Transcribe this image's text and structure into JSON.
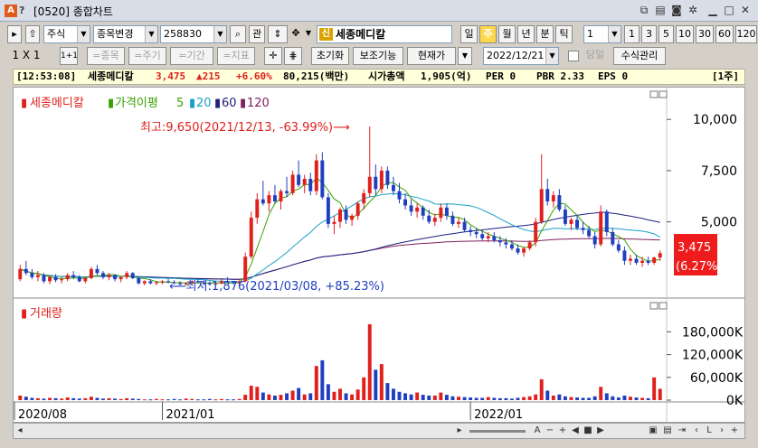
{
  "window": {
    "title": "[0520] 종합차트",
    "icons": [
      "app-icon",
      "help-icon",
      "new-window-icon",
      "copy-icon",
      "screenshot-icon",
      "settings-icon",
      "minimize-icon",
      "maximize-icon",
      "close-icon"
    ]
  },
  "toolbar1": {
    "market": "주식",
    "stock_change": "종목변경",
    "code": "258830",
    "search_icon": "search-icon",
    "relation_btn": "관",
    "stock_name": "세종메디칼",
    "stock_badge": "신",
    "period_buttons": [
      "일",
      "주",
      "월",
      "년",
      "분",
      "틱"
    ],
    "selected_period": "주",
    "unit_value": "1",
    "unit_buttons": [
      "1",
      "3",
      "5",
      "10",
      "30",
      "60",
      "120"
    ]
  },
  "toolbar2": {
    "layout": "1 X 1",
    "layout_btn": "1+1",
    "tools": [
      "=종목",
      "=주기",
      "=기간",
      "=지표"
    ],
    "reset_btn": "초기화",
    "aux_btn": "보조기능",
    "price_mode": "현재가",
    "date": "2022/12/21",
    "today_label": "당일",
    "formula_btn": "수식관리"
  },
  "infobar": {
    "time": "[12:53:08]",
    "name": "세종메디칼",
    "price": "3,475",
    "change": "▲215",
    "change_pct": "+6.60%",
    "volume": "80,215(백만)",
    "mcap_label": "시가총액",
    "mcap": "1,905(억)",
    "per": "PER 0",
    "pbr": "PBR 2.33",
    "eps": "EPS 0",
    "period_tag": "[1주]"
  },
  "chart": {
    "legend": {
      "stock": "세종메디칼",
      "ma_label": "가격이평",
      "ma": [
        "5",
        "20",
        "60",
        "120"
      ]
    },
    "high_note": "최고:9,650(2021/12/13, -63.99%)⟶",
    "low_note": "⟵최저:1,876(2021/03/08, +85.23%)",
    "price_ticks": [
      "10,000",
      "7,500",
      "5,000"
    ],
    "current_price": "3,475",
    "current_pct": "(6.27%)",
    "volume_label": "거래량",
    "volume_ticks": [
      "180,000K",
      "120,000K",
      "60,000K",
      "0K"
    ],
    "x_labels": [
      "2020/08",
      "2021/01",
      "2022/01"
    ],
    "colors": {
      "up": "#e0201c",
      "down": "#1f3fc0",
      "ma5": "#3aa000",
      "ma20": "#1aa0c8",
      "ma60": "#202080",
      "ma120": "#802060"
    }
  },
  "chart_data": {
    "type": "candlestick",
    "title": "",
    "ylim": [
      1500,
      11200
    ],
    "price_axis_ticks": [
      5000,
      7500,
      10000
    ],
    "high": {
      "value": 9650,
      "date": "2021/12/13"
    },
    "low": {
      "value": 1876,
      "date": "2021/03/08"
    },
    "last_close": 3475,
    "x_ticks": [
      "2020/08",
      "2021/01",
      "2022/01"
    ],
    "volume_ylim": [
      0,
      200000
    ],
    "volume_axis_ticks": [
      0,
      60000,
      120000,
      180000
    ],
    "ohlc_weekly": [
      [
        2200,
        2900,
        2100,
        2700
      ],
      [
        2700,
        3100,
        2400,
        2500
      ],
      [
        2500,
        2700,
        2200,
        2300
      ],
      [
        2300,
        2600,
        2100,
        2400
      ],
      [
        2400,
        2500,
        2000,
        2100
      ],
      [
        2100,
        2400,
        1950,
        2300
      ],
      [
        2300,
        2450,
        2050,
        2150
      ],
      [
        2150,
        2300,
        2000,
        2200
      ],
      [
        2200,
        2500,
        2100,
        2400
      ],
      [
        2400,
        2600,
        2200,
        2300
      ],
      [
        2300,
        2400,
        2050,
        2100
      ],
      [
        2100,
        2300,
        2000,
        2250
      ],
      [
        2250,
        2800,
        2200,
        2700
      ],
      [
        2700,
        2900,
        2400,
        2500
      ],
      [
        2500,
        2600,
        2200,
        2300
      ],
      [
        2300,
        2500,
        2150,
        2400
      ],
      [
        2400,
        2450,
        2100,
        2200
      ],
      [
        2200,
        2350,
        2050,
        2300
      ],
      [
        2300,
        2600,
        2200,
        2500
      ],
      [
        2500,
        2550,
        2200,
        2250
      ],
      [
        2250,
        2300,
        1950,
        2000
      ],
      [
        2000,
        2150,
        1900,
        2100
      ],
      [
        2100,
        2200,
        1950,
        2000
      ],
      [
        2000,
        2100,
        1900,
        2050
      ],
      [
        2050,
        2150,
        1950,
        2100
      ],
      [
        2100,
        2200,
        2000,
        2050
      ],
      [
        2050,
        2150,
        1950,
        2000
      ],
      [
        2000,
        2100,
        1900,
        1950
      ],
      [
        1950,
        2050,
        1876,
        2000
      ],
      [
        2000,
        2150,
        1950,
        2100
      ],
      [
        2100,
        2200,
        2000,
        2050
      ],
      [
        2050,
        2150,
        1950,
        2000
      ],
      [
        2000,
        2100,
        1900,
        1950
      ],
      [
        1950,
        2050,
        1900,
        2000
      ],
      [
        2000,
        2200,
        1950,
        2100
      ],
      [
        2100,
        2300,
        2000,
        2050
      ],
      [
        2050,
        2100,
        1950,
        2000
      ],
      [
        2000,
        2150,
        1950,
        2100
      ],
      [
        2100,
        3500,
        2050,
        3300
      ],
      [
        3300,
        5500,
        3200,
        5200
      ],
      [
        5200,
        6400,
        4900,
        6100
      ],
      [
        6100,
        7000,
        5800,
        5900
      ],
      [
        5900,
        6500,
        5500,
        6300
      ],
      [
        6300,
        6800,
        5900,
        6000
      ],
      [
        6000,
        6600,
        5600,
        6500
      ],
      [
        6500,
        7200,
        6200,
        6400
      ],
      [
        6400,
        7500,
        6300,
        7300
      ],
      [
        7300,
        8000,
        6700,
        6800
      ],
      [
        6800,
        7300,
        6400,
        7100
      ],
      [
        7100,
        7400,
        6300,
        6500
      ],
      [
        6500,
        8300,
        6300,
        8000
      ],
      [
        8000,
        8400,
        6100,
        6200
      ],
      [
        6200,
        6400,
        4700,
        4900
      ],
      [
        4900,
        5300,
        4400,
        5000
      ],
      [
        5000,
        5700,
        4700,
        5600
      ],
      [
        5600,
        5800,
        4900,
        5100
      ],
      [
        5100,
        5400,
        4800,
        5300
      ],
      [
        5300,
        6000,
        5100,
        5900
      ],
      [
        5900,
        6600,
        5600,
        6400
      ],
      [
        6400,
        9650,
        6200,
        7200
      ],
      [
        7200,
        7800,
        6300,
        6600
      ],
      [
        6600,
        7700,
        6400,
        7500
      ],
      [
        7500,
        7700,
        6600,
        6800
      ],
      [
        6800,
        7200,
        6300,
        6500
      ],
      [
        6500,
        6900,
        5900,
        6100
      ],
      [
        6100,
        6400,
        5600,
        5800
      ],
      [
        5800,
        6100,
        5300,
        5500
      ],
      [
        5500,
        5900,
        5200,
        5700
      ],
      [
        5700,
        5800,
        5100,
        5300
      ],
      [
        5300,
        5600,
        4900,
        5000
      ],
      [
        5000,
        5400,
        4800,
        5200
      ],
      [
        5200,
        5900,
        5000,
        5700
      ],
      [
        5700,
        5900,
        5100,
        5300
      ],
      [
        5300,
        5500,
        4800,
        4900
      ],
      [
        4900,
        5200,
        4700,
        5000
      ],
      [
        5000,
        5200,
        4500,
        4600
      ],
      [
        4600,
        4800,
        4300,
        4500
      ],
      [
        4500,
        4700,
        4200,
        4400
      ],
      [
        4400,
        4600,
        4100,
        4200
      ],
      [
        4200,
        4500,
        4000,
        4300
      ],
      [
        4300,
        4500,
        4000,
        4100
      ],
      [
        4100,
        4300,
        3800,
        4000
      ],
      [
        4000,
        4200,
        3700,
        3900
      ],
      [
        3900,
        4100,
        3600,
        3700
      ],
      [
        3700,
        3900,
        3400,
        3500
      ],
      [
        3500,
        3800,
        3300,
        3700
      ],
      [
        3700,
        4100,
        3600,
        4000
      ],
      [
        4000,
        5200,
        3800,
        5000
      ],
      [
        5000,
        8300,
        4900,
        6600
      ],
      [
        6600,
        7100,
        5800,
        6000
      ],
      [
        6000,
        6500,
        5700,
        6300
      ],
      [
        6300,
        6600,
        5500,
        5600
      ],
      [
        5600,
        5800,
        4800,
        4900
      ],
      [
        4900,
        5200,
        4600,
        5100
      ],
      [
        5100,
        5300,
        4600,
        4700
      ],
      [
        4700,
        5000,
        4400,
        4600
      ],
      [
        4600,
        4800,
        4200,
        4300
      ],
      [
        4300,
        4500,
        3700,
        3900
      ],
      [
        3900,
        5800,
        3800,
        5500
      ],
      [
        5500,
        5600,
        4300,
        4500
      ],
      [
        4500,
        4700,
        3800,
        3900
      ],
      [
        3900,
        4100,
        3500,
        3600
      ],
      [
        3600,
        3800,
        2900,
        3100
      ],
      [
        3100,
        3400,
        2900,
        3200
      ],
      [
        3200,
        3400,
        2900,
        3000
      ],
      [
        3000,
        3300,
        2800,
        3100
      ],
      [
        3100,
        3300,
        2900,
        3000
      ],
      [
        3000,
        3300,
        2900,
        3260
      ],
      [
        3260,
        3600,
        3100,
        3475
      ]
    ],
    "volume_weekly": [
      12000,
      9000,
      6000,
      5000,
      4000,
      6000,
      5000,
      4000,
      7000,
      5000,
      4000,
      5000,
      9000,
      6000,
      4000,
      5000,
      4000,
      3000,
      5000,
      4000,
      3000,
      2000,
      2000,
      3000,
      2000,
      2000,
      3000,
      2000,
      4000,
      3000,
      2000,
      2000,
      3000,
      2000,
      3000,
      2000,
      2000,
      3000,
      14000,
      38000,
      35000,
      20000,
      15000,
      12000,
      14000,
      18000,
      25000,
      32000,
      15000,
      18000,
      90000,
      105000,
      42000,
      22000,
      30000,
      18000,
      15000,
      28000,
      60000,
      200000,
      80000,
      95000,
      45000,
      30000,
      22000,
      18000,
      15000,
      20000,
      14000,
      12000,
      12000,
      20000,
      14000,
      10000,
      9000,
      8000,
      7000,
      6000,
      6000,
      8000,
      6000,
      5000,
      5000,
      4000,
      6000,
      8000,
      10000,
      15000,
      55000,
      25000,
      12000,
      15000,
      10000,
      8000,
      7000,
      6000,
      6000,
      10000,
      35000,
      18000,
      10000,
      7000,
      12000,
      9000,
      7000,
      6000,
      5000,
      60000,
      30000
    ]
  }
}
